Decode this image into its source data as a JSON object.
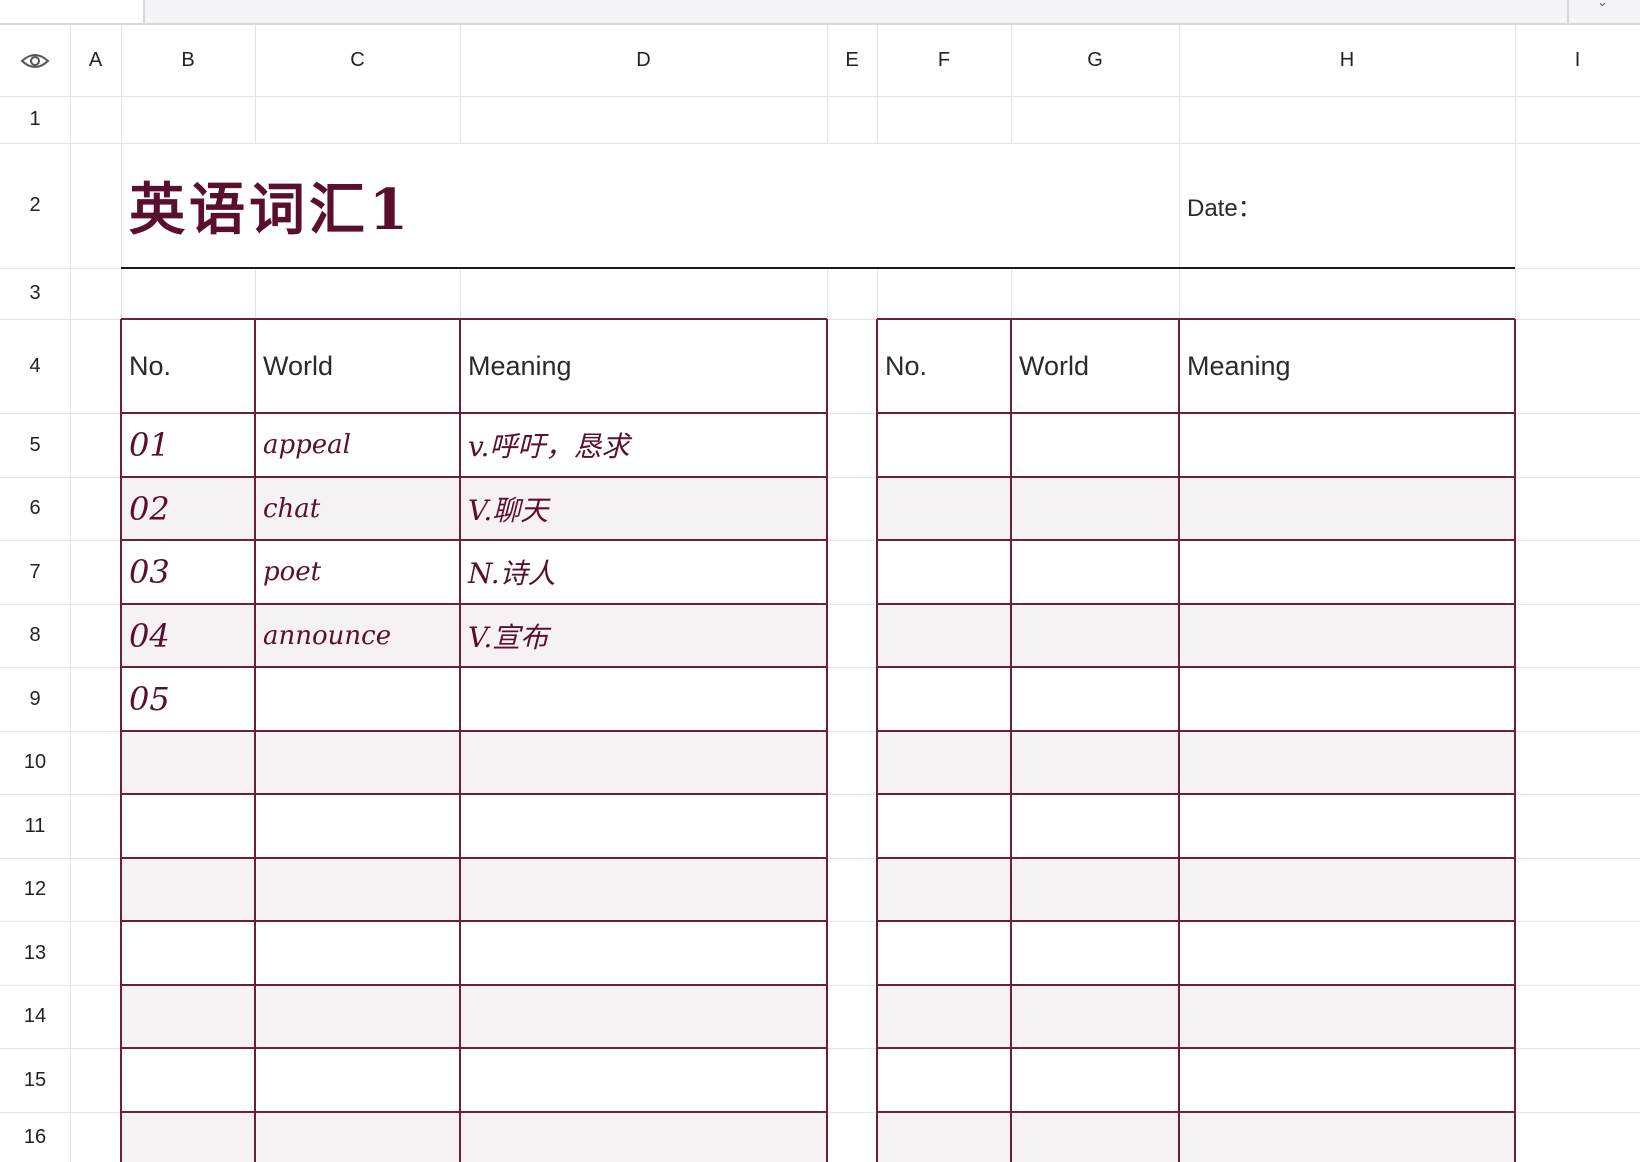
{
  "columns": [
    "A",
    "B",
    "C",
    "D",
    "E",
    "F",
    "G",
    "H",
    "I"
  ],
  "rows": [
    "1",
    "2",
    "3",
    "4",
    "5",
    "6",
    "7",
    "8",
    "9",
    "10",
    "11",
    "12",
    "13",
    "14",
    "15",
    "16"
  ],
  "sheet": {
    "title": "英语词汇1",
    "date_label": "Date："
  },
  "left_table": {
    "headers": [
      "No.",
      "World",
      "Meaning"
    ],
    "entries": [
      {
        "no": "01",
        "word": "appeal",
        "meaning": "v.呼吁，恳求"
      },
      {
        "no": "02",
        "word": "chat",
        "meaning": "V.聊天"
      },
      {
        "no": "03",
        "word": "poet",
        "meaning": "N.诗人"
      },
      {
        "no": "04",
        "word": "announce",
        "meaning": "V.宣布"
      },
      {
        "no": "05",
        "word": "",
        "meaning": ""
      }
    ]
  },
  "right_table": {
    "headers": [
      "No.",
      "World",
      "Meaning"
    ]
  },
  "colors": {
    "accent": "#6b1f3a",
    "text_accent": "#5a0f2e",
    "band": "#f6f2f4"
  },
  "icons": {
    "corner": "eye-icon"
  }
}
